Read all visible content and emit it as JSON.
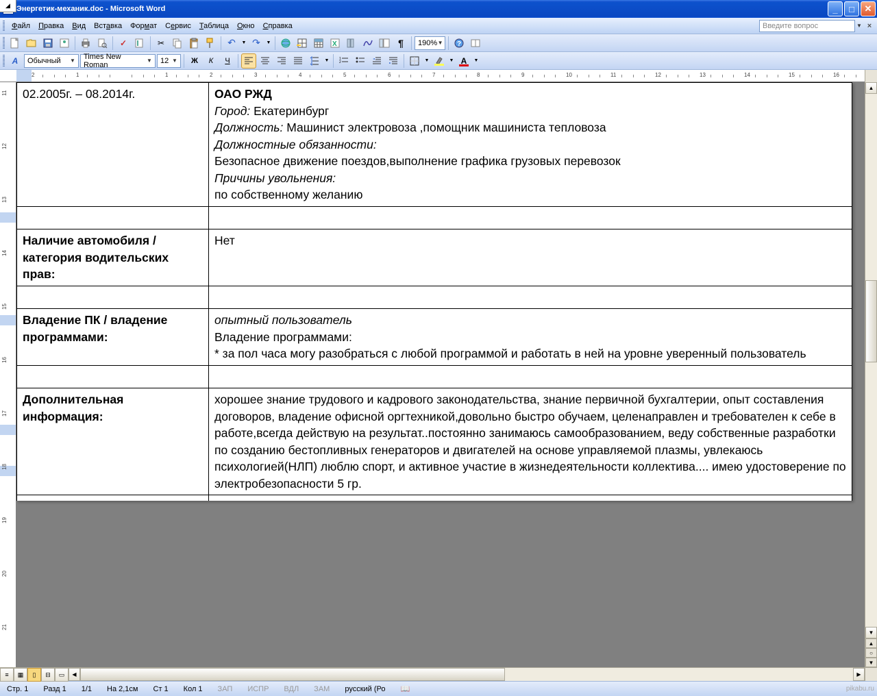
{
  "titlebar": {
    "caption": "Энергетик-механик.doc - Microsoft Word"
  },
  "menu": {
    "file": "Файл",
    "edit": "Правка",
    "view": "Вид",
    "insert": "Вставка",
    "format": "Формат",
    "service": "Сервис",
    "table": "Таблица",
    "window": "Окно",
    "help": "Справка",
    "help_placeholder": "Введите вопрос"
  },
  "toolbar": {
    "zoom": "190%"
  },
  "format_bar": {
    "style": "Обычный",
    "font": "Times New Roman",
    "size": "12",
    "bold": "Ж",
    "italic": "К",
    "underline": "Ч"
  },
  "ruler": {
    "h": [
      "2",
      "1",
      "",
      "1",
      "2",
      "3",
      "4",
      "5",
      "6",
      "7",
      "8",
      "9",
      "10",
      "11",
      "12",
      "13",
      "14",
      "15",
      "16"
    ],
    "v": [
      "11",
      "12",
      "13",
      "14",
      "15",
      "16",
      "17",
      "18",
      "19",
      "20",
      "21"
    ]
  },
  "doc": {
    "row1_date": "02.2005г. – 08.2014г.",
    "row1_company": "ОАО РЖД",
    "row1_city_l": "Город:",
    "row1_city_v": " Екатеринбург",
    "row1_pos_l": "Должность:",
    "row1_pos_v": " Машинист электровоза ,помощник машиниста тепловоза",
    "row1_duties_l": "Должностные обязанности:",
    "row1_duties_v": "Безопасное движение поездов,выполнение графика грузовых перевозок",
    "row1_reason_l": "Причины увольнения:",
    "row1_reason_v": "по собственному желанию",
    "row2_l": "Наличие автомобиля / категория водительских прав:",
    "row2_v": "Нет",
    "row3_l": "Владение ПК / владение программами:",
    "row3_skill": "опытный пользователь",
    "row3_progs_l": "Владение программами:",
    "row3_progs_v": "* за пол часа могу разобраться с любой программой и работать в ней на уровне  уверенный пользователь",
    "row4_l": "Дополнительная информация:",
    "row4_v": "хорошее знание трудового и кадрового законодательства, знание первичной бухгалтерии, опыт составления договоров, владение офисной оргтехникой,довольно быстро обучаем, целенаправлен и требователен к себе в работе,всегда действую на результат..постоянно занимаюсь самообразованием, веду собственные разработки по созданию бестопливных генераторов и двигателей на основе управляемой плазмы, увлекаюсь психологией(НЛП) люблю спорт, и активное участие в жизнедеятельности коллектива.... имею удостоверение по электробезопасности 5 гр."
  },
  "status": {
    "page": "Стр. 1",
    "section": "Разд 1",
    "pages": "1/1",
    "at": "На 2,1см",
    "line": "Ст 1",
    "col": "Кол 1",
    "rec": "ЗАП",
    "fix": "ИСПР",
    "ext": "ВДЛ",
    "ovr": "ЗАМ",
    "lang": "русский (Ро",
    "watermark": "pikabu.ru"
  }
}
